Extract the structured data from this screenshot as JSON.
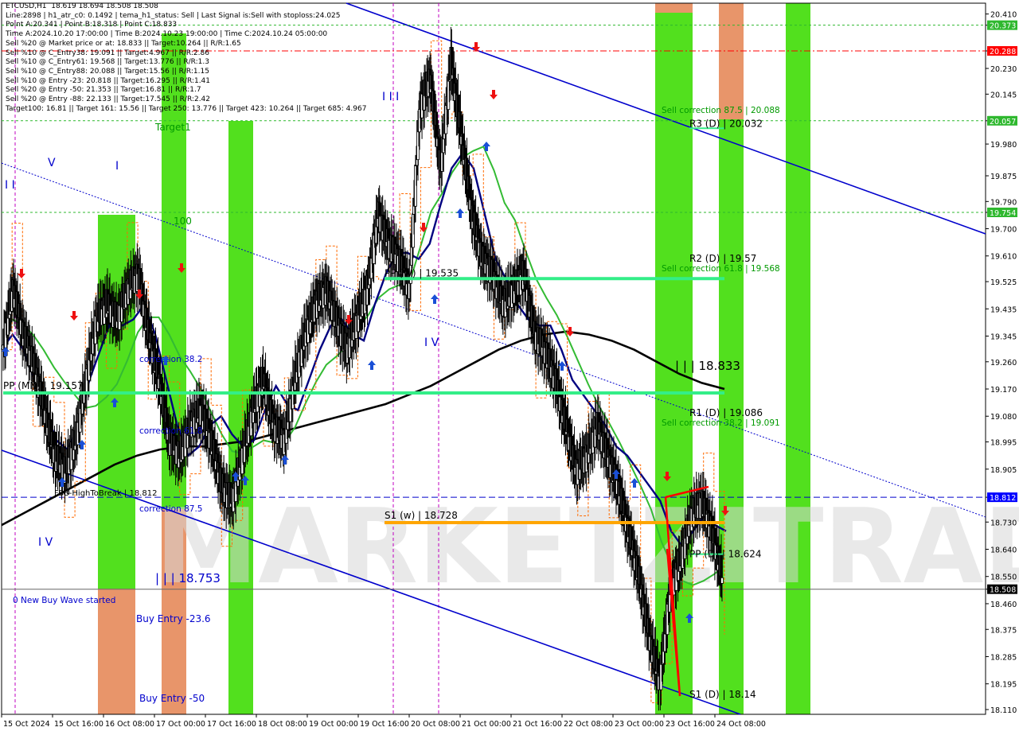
{
  "header": {
    "lines": [
      "ETCUSD,H1  18.619 18.694 18.508 18.508",
      "Line:2898 | h1_atr_c0: 0.1492 | tema_h1_status: Sell | Last Signal is:Sell with stoploss:24.025",
      "Point A:20.341 | Point B:18.318 | Point C:18.833",
      "Time A:2024.10.20 17:00:00 | Time B:2024.10.23 19:00:00 | Time C:2024.10.24 05:00:00",
      "Sell %20 @ Market price or at: 18.833 || Target:10.264 || R/R:1.65",
      "Sell %10 @ C_Entry38: 19.091 || Target:4.967 || R/R:2.86",
      "Sell %10 @ C_Entry61: 19.568 || Target:13.776 || R/R:1.3",
      "Sell %10 @ C_Entry88: 20.088 || Target:15.56 || R/R:1.15",
      "Sell %10 @ Entry -23: 20.818 || Target:16.295 || R/R:1.41",
      "Sell %20 @ Entry -50: 21.353 || Target:16.81 || R/R:1.7",
      "Sell %20 @ Entry -88: 22.133 || Target:17.545 || R/R:2.42",
      "Target100: 16.81 || Target 161: 15.56 || Target 250: 13.776 || Target 423: 10.264 || Target 685: 4.967"
    ]
  },
  "chart_data": {
    "type": "candlestick",
    "symbol": "ETCUSD",
    "timeframe": "H1",
    "ohlc_last": {
      "open": 18.619,
      "high": 18.694,
      "low": 18.508,
      "close": 18.508
    },
    "ylim": [
      18.11,
      20.43
    ],
    "y_ticks": [
      "20.410",
      "20.373",
      "20.288",
      "20.230",
      "20.145",
      "20.057",
      "19.980",
      "19.875",
      "19.790",
      "19.754",
      "19.700",
      "19.610",
      "19.525",
      "19.435",
      "19.345",
      "19.260",
      "19.170",
      "19.080",
      "18.995",
      "18.905",
      "18.812",
      "18.730",
      "18.640",
      "18.550",
      "18.508",
      "18.460",
      "18.375",
      "18.285",
      "18.195",
      "18.110"
    ],
    "highlighted_prices": [
      {
        "label": "20.373",
        "value": 20.373,
        "color": "#2fb82f"
      },
      {
        "label": "20.288",
        "value": 20.288,
        "color": "#ff0000"
      },
      {
        "label": "20.057",
        "value": 20.057,
        "color": "#2fb82f"
      },
      {
        "label": "19.754",
        "value": 19.754,
        "color": "#2fb82f"
      },
      {
        "label": "18.812",
        "value": 18.812,
        "color": "#0000ff"
      },
      {
        "label": "18.508",
        "value": 18.508,
        "color": "#000000"
      }
    ],
    "x_ticks": [
      "15 Oct 2024",
      "15 Oct 16:00",
      "16 Oct 08:00",
      "17 Oct 00:00",
      "17 Oct 16:00",
      "18 Oct 08:00",
      "19 Oct 00:00",
      "19 Oct 16:00",
      "20 Oct 08:00",
      "21 Oct 00:00",
      "21 Oct 16:00",
      "22 Oct 08:00",
      "23 Oct 00:00",
      "23 Oct 16:00",
      "24 Oct 08:00"
    ],
    "series": [
      {
        "name": "price",
        "values": [
          19.3,
          19.5,
          19.35,
          19.25,
          19.1,
          18.95,
          18.9,
          19.0,
          19.2,
          19.4,
          19.45,
          19.4,
          19.5,
          19.55,
          19.35,
          19.2,
          19.0,
          18.95,
          19.05,
          19.1,
          19.0,
          18.85,
          18.8,
          18.95,
          19.1,
          19.2,
          19.05,
          19.0,
          19.2,
          19.35,
          19.45,
          19.5,
          19.4,
          19.3,
          19.4,
          19.5,
          19.75,
          19.65,
          19.6,
          19.5,
          20.1,
          20.2,
          19.9,
          20.25,
          20.0,
          19.75,
          19.6,
          19.55,
          19.45,
          19.5,
          19.55,
          19.35,
          19.3,
          19.2,
          19.05,
          18.9,
          18.95,
          19.05,
          18.95,
          18.85,
          18.7,
          18.55,
          18.35,
          18.2,
          18.5,
          18.6,
          18.75,
          18.8,
          18.7,
          18.55
        ]
      },
      {
        "name": "tema_fast",
        "values": [
          19.3,
          19.35,
          19.3,
          19.2,
          19.1,
          19.0,
          18.97,
          19.05,
          19.2,
          19.3,
          19.4,
          19.38,
          19.4,
          19.45,
          19.35,
          19.2,
          19.05,
          18.95,
          18.98,
          19.05,
          19.08,
          19.02,
          18.98,
          19.0,
          19.1,
          19.18,
          19.12,
          19.1,
          19.2,
          19.3,
          19.38,
          19.4,
          19.35,
          19.33,
          19.45,
          19.55,
          19.62,
          19.62,
          19.6,
          19.65,
          19.78,
          19.9,
          19.95,
          19.9,
          19.75,
          19.6,
          19.53,
          19.45,
          19.4,
          19.38,
          19.38,
          19.3,
          19.2,
          19.15,
          19.1,
          19.05,
          18.98,
          18.95,
          18.9,
          18.85,
          18.8,
          18.7,
          18.65,
          18.7,
          18.75,
          18.72,
          18.7
        ]
      },
      {
        "name": "ma_slow",
        "values": [
          18.72,
          18.76,
          18.8,
          18.84,
          18.88,
          18.92,
          18.95,
          18.97,
          18.98,
          18.98,
          18.99,
          19.0,
          19.02,
          19.04,
          19.06,
          19.08,
          19.1,
          19.12,
          19.15,
          19.18,
          19.22,
          19.26,
          19.3,
          19.33,
          19.35,
          19.36,
          19.35,
          19.33,
          19.3,
          19.26,
          19.22,
          19.19,
          19.17
        ]
      }
    ],
    "levels": [
      {
        "label": "PP (W) | 19.535",
        "value": 19.535,
        "color": "#33ee88"
      },
      {
        "label": "PP (MN) | 19.157",
        "value": 19.157,
        "color": "#33ee88"
      },
      {
        "label": "S1 (w) | 18.728",
        "value": 18.728,
        "color": "#ffa500"
      },
      {
        "label": "FSB-HighToBreak | 18.812",
        "value": 18.812,
        "color": "#0000cc"
      },
      {
        "label": "R3 (D) | 20.032",
        "value": 20.032
      },
      {
        "label": "R2 (D) | 19.57",
        "value": 19.57
      },
      {
        "label": "R1 (D) | 19.086",
        "value": 19.086
      },
      {
        "label": "PP (D) | 18.624",
        "value": 18.624
      },
      {
        "label": "S1 (D) | 18.14",
        "value": 18.14
      }
    ],
    "annotations": {
      "sell_correction_875": "Sell correction 87.5 | 20.088",
      "sell_correction_618": "Sell correction 61.8 | 19.568",
      "sell_correction_382": "Sell correction 38.2 | 19.091",
      "wave_ii": "| | | 18.833",
      "wave_iii": "| | | 18.753",
      "correction_382": "correction 38.2",
      "correction_618": "correction 61.8",
      "correction_875": "correction 87.5",
      "new_buy_wave": "0 New Buy Wave started",
      "buy_entry_236": "Buy Entry -23.6",
      "buy_entry_50": "Buy Entry -50",
      "target1": "Target1",
      "level_100": "100",
      "roman_v": "V",
      "roman_i": "I",
      "roman_ii": "I I",
      "roman_iii": "I I I",
      "roman_iv_left": "I V",
      "roman_iv": "I V"
    },
    "watermark": "MARKETZITRADE",
    "colors": {
      "green": "#52e01e",
      "orange": "#e8956a",
      "blue_channel": "#0000cc",
      "tema": "#000080",
      "green_ma": "#33bb33",
      "black_ma": "#000000"
    }
  }
}
